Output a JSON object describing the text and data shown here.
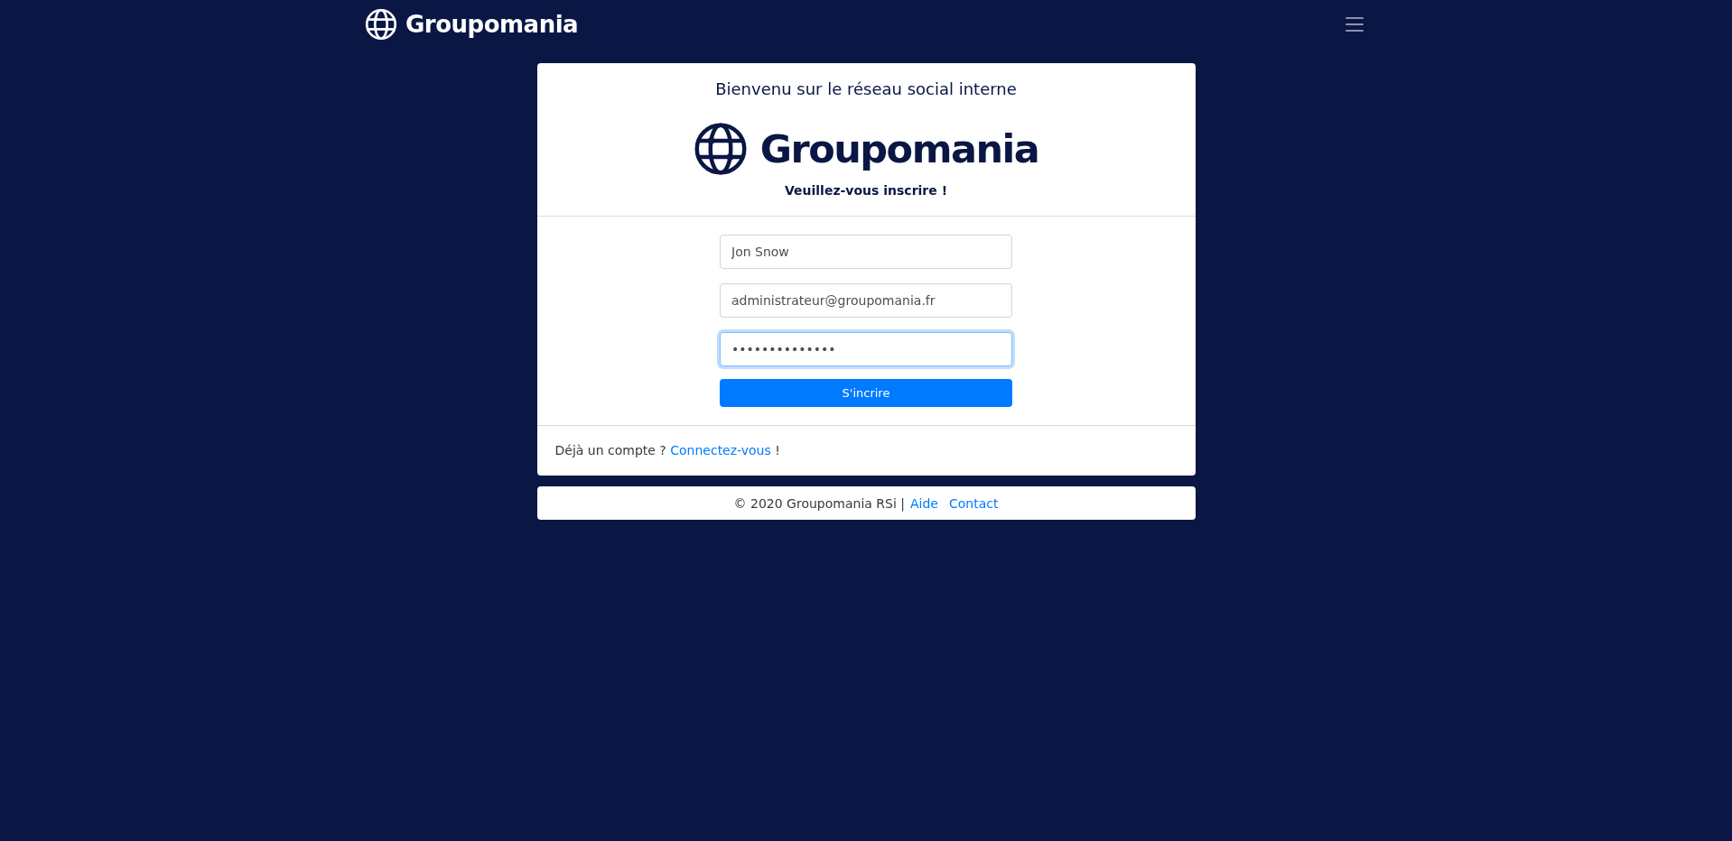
{
  "navbar": {
    "brand": "Groupomania"
  },
  "card": {
    "title": "Bienvenu sur le réseau social interne",
    "brand": "Groupomania",
    "subtitle": "Veuillez-vous inscrire !",
    "fields": [
      {
        "value": "Jon Snow",
        "focused": false
      },
      {
        "value": "administrateur@groupomania.fr",
        "focused": false
      },
      {
        "value": "••••••••••••••",
        "focused": true
      }
    ],
    "submit": "S'incrire",
    "login_prompt": {
      "before": "Déjà un compte ?",
      "link": "Connectez-vous",
      "after": "!"
    }
  },
  "footer": {
    "copyright": "© 2020 Groupomania RSi |",
    "links": [
      "Aide",
      "Contact"
    ]
  }
}
